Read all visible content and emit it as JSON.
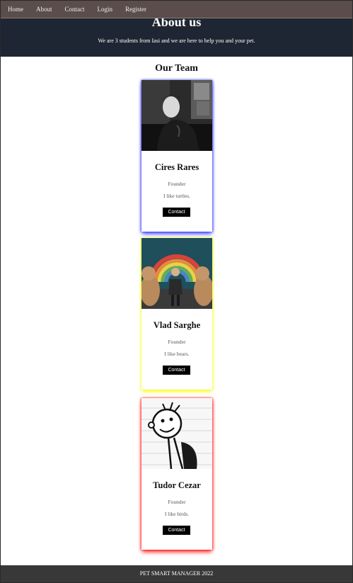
{
  "nav": {
    "items": [
      {
        "label": "Home"
      },
      {
        "label": "About"
      },
      {
        "label": "Contact"
      },
      {
        "label": "Login"
      },
      {
        "label": "Register"
      }
    ]
  },
  "hero": {
    "title": "About us",
    "subtitle": "We are 3 students from Iasi and we are here to help you and your pet."
  },
  "team": {
    "title": "Our Team",
    "members": [
      {
        "name": "Cires Rares",
        "role": "Founder",
        "description": "I like turtles.",
        "button_label": "Contact",
        "accent": "#4040ff"
      },
      {
        "name": "Vlad Sarghe",
        "role": "Founder",
        "description": "I like bears.",
        "button_label": "Contact",
        "accent": "#f4ff2a"
      },
      {
        "name": "Tudor Cezar",
        "role": "Founder",
        "description": "I like birds.",
        "button_label": "Contact",
        "accent": "#ff1a1a"
      }
    ]
  },
  "footer": {
    "text": "PET SMART MANAGER 2022"
  }
}
